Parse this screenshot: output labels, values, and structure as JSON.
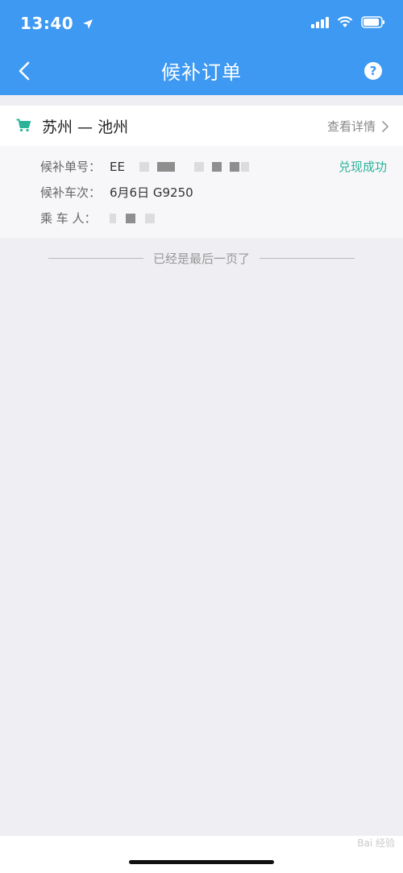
{
  "status_bar": {
    "time": "13:40"
  },
  "nav": {
    "title": "候补订单",
    "help_symbol": "?"
  },
  "order": {
    "route": "苏州 — 池州",
    "detail_link": "查看详情",
    "status": "兑现成功",
    "fields": [
      {
        "label": "候补单号：",
        "value": "EE"
      },
      {
        "label": "候补车次：",
        "value": "6月6日 G9250"
      },
      {
        "label": "乘 车 人：",
        "value": ""
      }
    ]
  },
  "footer": {
    "end_text": "已经是最后一页了"
  },
  "watermark": "Bai 经验",
  "colors": {
    "primary": "#3d99f2",
    "success": "#2bb39a",
    "background": "#eeeef3"
  }
}
